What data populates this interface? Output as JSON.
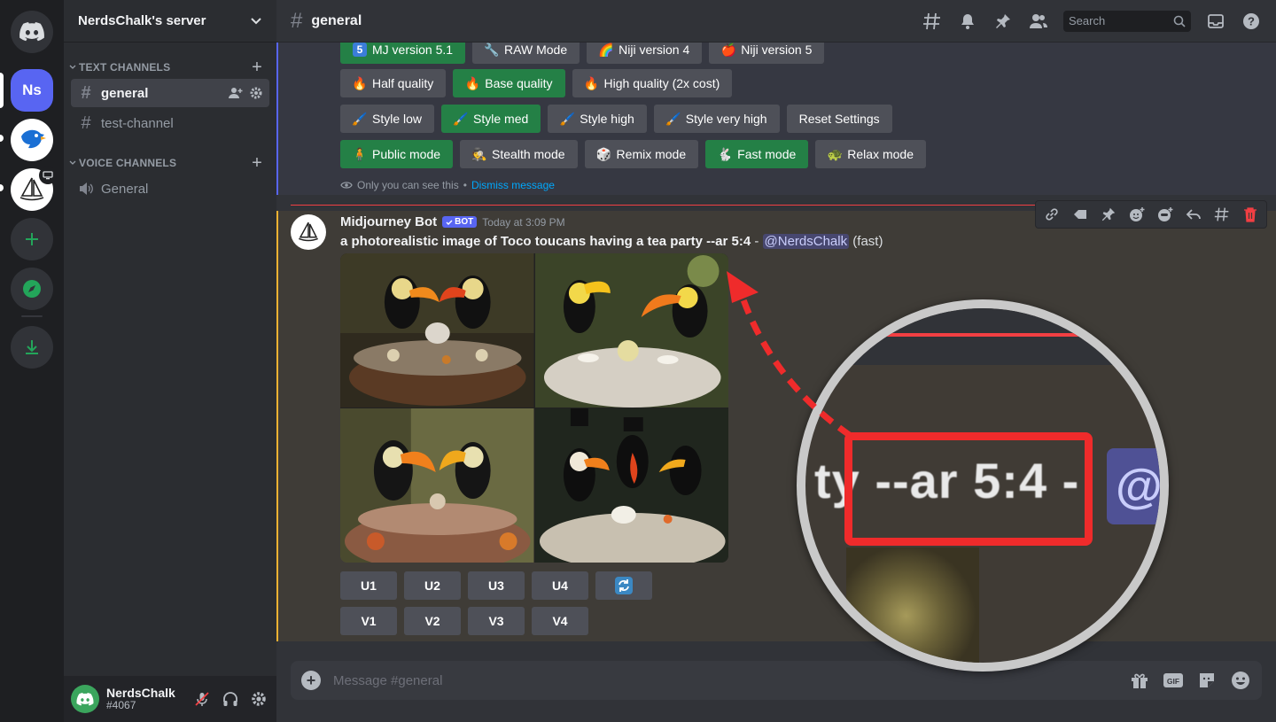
{
  "server": {
    "name": "NerdsChalk's server"
  },
  "rail": {
    "ns_label": "Ns"
  },
  "categories": {
    "text": "TEXT CHANNELS",
    "voice": "VOICE CHANNELS"
  },
  "channels": {
    "text": [
      {
        "name": "general",
        "active": true
      },
      {
        "name": "test-channel",
        "active": false
      }
    ],
    "voice": [
      {
        "name": "General"
      }
    ]
  },
  "user": {
    "name": "NerdsChalk",
    "tag": "#4067"
  },
  "topbar": {
    "channel": "general",
    "search_placeholder": "Search"
  },
  "ephemeral": {
    "rows": [
      [
        {
          "emoji": "5",
          "label": "MJ version 5.1",
          "active": true
        },
        {
          "emoji": "🔧",
          "label": "RAW Mode",
          "active": false
        },
        {
          "emoji": "🌈",
          "label": "Niji version 4",
          "active": false
        },
        {
          "emoji": "🍎",
          "label": "Niji version 5",
          "active": false
        }
      ],
      [
        {
          "emoji": "🔥",
          "label": "Half quality",
          "active": false
        },
        {
          "emoji": "🔥",
          "label": "Base quality",
          "active": true
        },
        {
          "emoji": "🔥",
          "label": "High quality (2x cost)",
          "active": false
        }
      ],
      [
        {
          "emoji": "🖌️",
          "label": "Style low",
          "active": false
        },
        {
          "emoji": "🖌️",
          "label": "Style med",
          "active": true
        },
        {
          "emoji": "🖌️",
          "label": "Style high",
          "active": false
        },
        {
          "emoji": "🖌️",
          "label": "Style very high",
          "active": false
        },
        {
          "emoji": "",
          "label": "Reset Settings",
          "active": false
        }
      ],
      [
        {
          "emoji": "🧍",
          "label": "Public mode",
          "active": true
        },
        {
          "emoji": "🕵️",
          "label": "Stealth mode",
          "active": false
        },
        {
          "emoji": "🎲",
          "label": "Remix mode",
          "active": false
        },
        {
          "emoji": "🐇",
          "label": "Fast mode",
          "active": true
        },
        {
          "emoji": "🐢",
          "label": "Relax mode",
          "active": false
        }
      ]
    ],
    "note": "Only you can see this",
    "note_sep": " • ",
    "dismiss": "Dismiss message"
  },
  "message": {
    "author": "Midjourney Bot",
    "badge": "BOT",
    "timestamp": "Today at 3:09 PM",
    "prompt": "a photorealistic image of Toco toucans having a tea party --ar 5:4",
    "dash": " - ",
    "mention": "@NerdsChalk",
    "mode": "(fast)",
    "upscale": [
      "U1",
      "U2",
      "U3",
      "U4"
    ],
    "variation": [
      "V1",
      "V2",
      "V3",
      "V4"
    ],
    "reroll_icon": "refresh-icon"
  },
  "composer": {
    "placeholder": "Message #general",
    "gif_label": "GIF"
  },
  "magnifier": {
    "text": "ty --ar 5:4 -",
    "chip": "@"
  },
  "colors": {
    "accent": "#5865f2",
    "green": "#248046",
    "highlight": "#ef2b2b",
    "bot_border": "#f0b232"
  }
}
